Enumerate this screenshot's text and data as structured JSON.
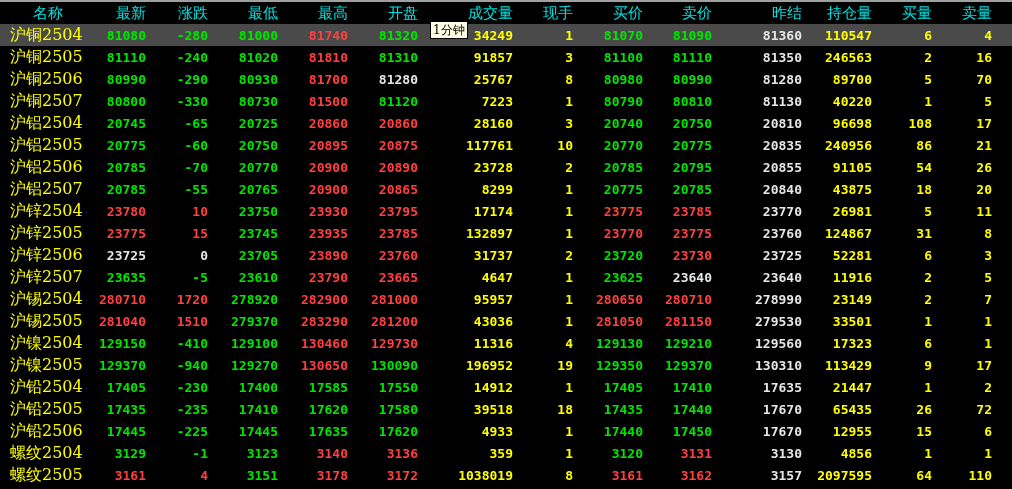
{
  "columns": [
    "名称",
    "最新",
    "涨跌",
    "最低",
    "最高",
    "开盘",
    "成交量",
    "现手",
    "买价",
    "卖价",
    "昨结",
    "持仓量",
    "买量",
    "卖量"
  ],
  "tooltip": {
    "text": "1分钟"
  },
  "rows": [
    {
      "name": "沪铜2504",
      "selected": true,
      "cells": [
        {
          "text": "81080",
          "color": "#00e600"
        },
        {
          "text": "-280",
          "color": "#00e600"
        },
        {
          "text": "81000",
          "color": "#00e600"
        },
        {
          "text": "81740",
          "color": "#ff4040"
        },
        {
          "text": "81320",
          "color": "#00e600"
        },
        {
          "text": "34249",
          "color": "#ffff00"
        },
        {
          "text": "1",
          "color": "#ffff00"
        },
        {
          "text": "81070",
          "color": "#00e600"
        },
        {
          "text": "81090",
          "color": "#00e600"
        },
        {
          "text": "81360",
          "color": "#e6e6e6"
        },
        {
          "text": "110547",
          "color": "#ffff00"
        },
        {
          "text": "6",
          "color": "#ffff00"
        },
        {
          "text": "4",
          "color": "#ffff00"
        }
      ]
    },
    {
      "name": "沪铜2505",
      "selected": false,
      "cells": [
        {
          "text": "81110",
          "color": "#00e600"
        },
        {
          "text": "-240",
          "color": "#00e600"
        },
        {
          "text": "81020",
          "color": "#00e600"
        },
        {
          "text": "81810",
          "color": "#ff4040"
        },
        {
          "text": "81310",
          "color": "#00e600"
        },
        {
          "text": "91857",
          "color": "#ffff00"
        },
        {
          "text": "3",
          "color": "#ffff00"
        },
        {
          "text": "81100",
          "color": "#00e600"
        },
        {
          "text": "81110",
          "color": "#00e600"
        },
        {
          "text": "81350",
          "color": "#e6e6e6"
        },
        {
          "text": "246563",
          "color": "#ffff00"
        },
        {
          "text": "2",
          "color": "#ffff00"
        },
        {
          "text": "16",
          "color": "#ffff00"
        }
      ]
    },
    {
      "name": "沪铜2506",
      "selected": false,
      "cells": [
        {
          "text": "80990",
          "color": "#00e600"
        },
        {
          "text": "-290",
          "color": "#00e600"
        },
        {
          "text": "80930",
          "color": "#00e600"
        },
        {
          "text": "81700",
          "color": "#ff4040"
        },
        {
          "text": "81280",
          "color": "#e6e6e6"
        },
        {
          "text": "25767",
          "color": "#ffff00"
        },
        {
          "text": "8",
          "color": "#ffff00"
        },
        {
          "text": "80980",
          "color": "#00e600"
        },
        {
          "text": "80990",
          "color": "#00e600"
        },
        {
          "text": "81280",
          "color": "#e6e6e6"
        },
        {
          "text": "89700",
          "color": "#ffff00"
        },
        {
          "text": "5",
          "color": "#ffff00"
        },
        {
          "text": "70",
          "color": "#ffff00"
        }
      ]
    },
    {
      "name": "沪铜2507",
      "selected": false,
      "cells": [
        {
          "text": "80800",
          "color": "#00e600"
        },
        {
          "text": "-330",
          "color": "#00e600"
        },
        {
          "text": "80730",
          "color": "#00e600"
        },
        {
          "text": "81500",
          "color": "#ff4040"
        },
        {
          "text": "81120",
          "color": "#00e600"
        },
        {
          "text": "7223",
          "color": "#ffff00"
        },
        {
          "text": "1",
          "color": "#ffff00"
        },
        {
          "text": "80790",
          "color": "#00e600"
        },
        {
          "text": "80810",
          "color": "#00e600"
        },
        {
          "text": "81130",
          "color": "#e6e6e6"
        },
        {
          "text": "40220",
          "color": "#ffff00"
        },
        {
          "text": "1",
          "color": "#ffff00"
        },
        {
          "text": "5",
          "color": "#ffff00"
        }
      ]
    },
    {
      "name": "沪铝2504",
      "selected": false,
      "cells": [
        {
          "text": "20745",
          "color": "#00e600"
        },
        {
          "text": "-65",
          "color": "#00e600"
        },
        {
          "text": "20725",
          "color": "#00e600"
        },
        {
          "text": "20860",
          "color": "#ff4040"
        },
        {
          "text": "20860",
          "color": "#ff4040"
        },
        {
          "text": "28160",
          "color": "#ffff00"
        },
        {
          "text": "3",
          "color": "#ffff00"
        },
        {
          "text": "20740",
          "color": "#00e600"
        },
        {
          "text": "20750",
          "color": "#00e600"
        },
        {
          "text": "20810",
          "color": "#e6e6e6"
        },
        {
          "text": "96698",
          "color": "#ffff00"
        },
        {
          "text": "108",
          "color": "#ffff00"
        },
        {
          "text": "17",
          "color": "#ffff00"
        }
      ]
    },
    {
      "name": "沪铝2505",
      "selected": false,
      "cells": [
        {
          "text": "20775",
          "color": "#00e600"
        },
        {
          "text": "-60",
          "color": "#00e600"
        },
        {
          "text": "20750",
          "color": "#00e600"
        },
        {
          "text": "20895",
          "color": "#ff4040"
        },
        {
          "text": "20875",
          "color": "#ff4040"
        },
        {
          "text": "117761",
          "color": "#ffff00"
        },
        {
          "text": "10",
          "color": "#ffff00"
        },
        {
          "text": "20770",
          "color": "#00e600"
        },
        {
          "text": "20775",
          "color": "#00e600"
        },
        {
          "text": "20835",
          "color": "#e6e6e6"
        },
        {
          "text": "240956",
          "color": "#ffff00"
        },
        {
          "text": "86",
          "color": "#ffff00"
        },
        {
          "text": "21",
          "color": "#ffff00"
        }
      ]
    },
    {
      "name": "沪铝2506",
      "selected": false,
      "cells": [
        {
          "text": "20785",
          "color": "#00e600"
        },
        {
          "text": "-70",
          "color": "#00e600"
        },
        {
          "text": "20770",
          "color": "#00e600"
        },
        {
          "text": "20900",
          "color": "#ff4040"
        },
        {
          "text": "20890",
          "color": "#ff4040"
        },
        {
          "text": "23728",
          "color": "#ffff00"
        },
        {
          "text": "2",
          "color": "#ffff00"
        },
        {
          "text": "20785",
          "color": "#00e600"
        },
        {
          "text": "20795",
          "color": "#00e600"
        },
        {
          "text": "20855",
          "color": "#e6e6e6"
        },
        {
          "text": "91105",
          "color": "#ffff00"
        },
        {
          "text": "54",
          "color": "#ffff00"
        },
        {
          "text": "26",
          "color": "#ffff00"
        }
      ]
    },
    {
      "name": "沪铝2507",
      "selected": false,
      "cells": [
        {
          "text": "20785",
          "color": "#00e600"
        },
        {
          "text": "-55",
          "color": "#00e600"
        },
        {
          "text": "20765",
          "color": "#00e600"
        },
        {
          "text": "20900",
          "color": "#ff4040"
        },
        {
          "text": "20865",
          "color": "#ff4040"
        },
        {
          "text": "8299",
          "color": "#ffff00"
        },
        {
          "text": "1",
          "color": "#ffff00"
        },
        {
          "text": "20775",
          "color": "#00e600"
        },
        {
          "text": "20785",
          "color": "#00e600"
        },
        {
          "text": "20840",
          "color": "#e6e6e6"
        },
        {
          "text": "43875",
          "color": "#ffff00"
        },
        {
          "text": "18",
          "color": "#ffff00"
        },
        {
          "text": "20",
          "color": "#ffff00"
        }
      ]
    },
    {
      "name": "沪锌2504",
      "selected": false,
      "cells": [
        {
          "text": "23780",
          "color": "#ff4040"
        },
        {
          "text": "10",
          "color": "#ff4040"
        },
        {
          "text": "23750",
          "color": "#00e600"
        },
        {
          "text": "23930",
          "color": "#ff4040"
        },
        {
          "text": "23795",
          "color": "#ff4040"
        },
        {
          "text": "17174",
          "color": "#ffff00"
        },
        {
          "text": "1",
          "color": "#ffff00"
        },
        {
          "text": "23775",
          "color": "#ff4040"
        },
        {
          "text": "23785",
          "color": "#ff4040"
        },
        {
          "text": "23770",
          "color": "#e6e6e6"
        },
        {
          "text": "26981",
          "color": "#ffff00"
        },
        {
          "text": "5",
          "color": "#ffff00"
        },
        {
          "text": "11",
          "color": "#ffff00"
        }
      ]
    },
    {
      "name": "沪锌2505",
      "selected": false,
      "cells": [
        {
          "text": "23775",
          "color": "#ff4040"
        },
        {
          "text": "15",
          "color": "#ff4040"
        },
        {
          "text": "23745",
          "color": "#00e600"
        },
        {
          "text": "23935",
          "color": "#ff4040"
        },
        {
          "text": "23785",
          "color": "#ff4040"
        },
        {
          "text": "132897",
          "color": "#ffff00"
        },
        {
          "text": "1",
          "color": "#ffff00"
        },
        {
          "text": "23770",
          "color": "#ff4040"
        },
        {
          "text": "23775",
          "color": "#ff4040"
        },
        {
          "text": "23760",
          "color": "#e6e6e6"
        },
        {
          "text": "124867",
          "color": "#ffff00"
        },
        {
          "text": "31",
          "color": "#ffff00"
        },
        {
          "text": "8",
          "color": "#ffff00"
        }
      ]
    },
    {
      "name": "沪锌2506",
      "selected": false,
      "cells": [
        {
          "text": "23725",
          "color": "#e6e6e6"
        },
        {
          "text": "0",
          "color": "#e6e6e6"
        },
        {
          "text": "23705",
          "color": "#00e600"
        },
        {
          "text": "23890",
          "color": "#ff4040"
        },
        {
          "text": "23760",
          "color": "#ff4040"
        },
        {
          "text": "31737",
          "color": "#ffff00"
        },
        {
          "text": "2",
          "color": "#ffff00"
        },
        {
          "text": "23720",
          "color": "#00e600"
        },
        {
          "text": "23730",
          "color": "#ff4040"
        },
        {
          "text": "23725",
          "color": "#e6e6e6"
        },
        {
          "text": "52281",
          "color": "#ffff00"
        },
        {
          "text": "6",
          "color": "#ffff00"
        },
        {
          "text": "3",
          "color": "#ffff00"
        }
      ]
    },
    {
      "name": "沪锌2507",
      "selected": false,
      "cells": [
        {
          "text": "23635",
          "color": "#00e600"
        },
        {
          "text": "-5",
          "color": "#00e600"
        },
        {
          "text": "23610",
          "color": "#00e600"
        },
        {
          "text": "23790",
          "color": "#ff4040"
        },
        {
          "text": "23665",
          "color": "#ff4040"
        },
        {
          "text": "4647",
          "color": "#ffff00"
        },
        {
          "text": "1",
          "color": "#ffff00"
        },
        {
          "text": "23625",
          "color": "#00e600"
        },
        {
          "text": "23640",
          "color": "#e6e6e6"
        },
        {
          "text": "23640",
          "color": "#e6e6e6"
        },
        {
          "text": "11916",
          "color": "#ffff00"
        },
        {
          "text": "2",
          "color": "#ffff00"
        },
        {
          "text": "5",
          "color": "#ffff00"
        }
      ]
    },
    {
      "name": "沪锡2504",
      "selected": false,
      "cells": [
        {
          "text": "280710",
          "color": "#ff4040"
        },
        {
          "text": "1720",
          "color": "#ff4040"
        },
        {
          "text": "278920",
          "color": "#00e600"
        },
        {
          "text": "282900",
          "color": "#ff4040"
        },
        {
          "text": "281000",
          "color": "#ff4040"
        },
        {
          "text": "95957",
          "color": "#ffff00"
        },
        {
          "text": "1",
          "color": "#ffff00"
        },
        {
          "text": "280650",
          "color": "#ff4040"
        },
        {
          "text": "280710",
          "color": "#ff4040"
        },
        {
          "text": "278990",
          "color": "#e6e6e6"
        },
        {
          "text": "23149",
          "color": "#ffff00"
        },
        {
          "text": "2",
          "color": "#ffff00"
        },
        {
          "text": "7",
          "color": "#ffff00"
        }
      ]
    },
    {
      "name": "沪锡2505",
      "selected": false,
      "cells": [
        {
          "text": "281040",
          "color": "#ff4040"
        },
        {
          "text": "1510",
          "color": "#ff4040"
        },
        {
          "text": "279370",
          "color": "#00e600"
        },
        {
          "text": "283290",
          "color": "#ff4040"
        },
        {
          "text": "281200",
          "color": "#ff4040"
        },
        {
          "text": "43036",
          "color": "#ffff00"
        },
        {
          "text": "1",
          "color": "#ffff00"
        },
        {
          "text": "281050",
          "color": "#ff4040"
        },
        {
          "text": "281150",
          "color": "#ff4040"
        },
        {
          "text": "279530",
          "color": "#e6e6e6"
        },
        {
          "text": "33501",
          "color": "#ffff00"
        },
        {
          "text": "1",
          "color": "#ffff00"
        },
        {
          "text": "1",
          "color": "#ffff00"
        }
      ]
    },
    {
      "name": "沪镍2504",
      "selected": false,
      "cells": [
        {
          "text": "129150",
          "color": "#00e600"
        },
        {
          "text": "-410",
          "color": "#00e600"
        },
        {
          "text": "129100",
          "color": "#00e600"
        },
        {
          "text": "130460",
          "color": "#ff4040"
        },
        {
          "text": "129730",
          "color": "#ff4040"
        },
        {
          "text": "11316",
          "color": "#ffff00"
        },
        {
          "text": "4",
          "color": "#ffff00"
        },
        {
          "text": "129130",
          "color": "#00e600"
        },
        {
          "text": "129210",
          "color": "#00e600"
        },
        {
          "text": "129560",
          "color": "#e6e6e6"
        },
        {
          "text": "17323",
          "color": "#ffff00"
        },
        {
          "text": "6",
          "color": "#ffff00"
        },
        {
          "text": "1",
          "color": "#ffff00"
        }
      ]
    },
    {
      "name": "沪镍2505",
      "selected": false,
      "cells": [
        {
          "text": "129370",
          "color": "#00e600"
        },
        {
          "text": "-940",
          "color": "#00e600"
        },
        {
          "text": "129270",
          "color": "#00e600"
        },
        {
          "text": "130650",
          "color": "#ff4040"
        },
        {
          "text": "130090",
          "color": "#00e600"
        },
        {
          "text": "196952",
          "color": "#ffff00"
        },
        {
          "text": "19",
          "color": "#ffff00"
        },
        {
          "text": "129350",
          "color": "#00e600"
        },
        {
          "text": "129370",
          "color": "#00e600"
        },
        {
          "text": "130310",
          "color": "#e6e6e6"
        },
        {
          "text": "113429",
          "color": "#ffff00"
        },
        {
          "text": "9",
          "color": "#ffff00"
        },
        {
          "text": "17",
          "color": "#ffff00"
        }
      ]
    },
    {
      "name": "沪铅2504",
      "selected": false,
      "cells": [
        {
          "text": "17405",
          "color": "#00e600"
        },
        {
          "text": "-230",
          "color": "#00e600"
        },
        {
          "text": "17400",
          "color": "#00e600"
        },
        {
          "text": "17585",
          "color": "#00e600"
        },
        {
          "text": "17550",
          "color": "#00e600"
        },
        {
          "text": "14912",
          "color": "#ffff00"
        },
        {
          "text": "1",
          "color": "#ffff00"
        },
        {
          "text": "17405",
          "color": "#00e600"
        },
        {
          "text": "17410",
          "color": "#00e600"
        },
        {
          "text": "17635",
          "color": "#e6e6e6"
        },
        {
          "text": "21447",
          "color": "#ffff00"
        },
        {
          "text": "1",
          "color": "#ffff00"
        },
        {
          "text": "2",
          "color": "#ffff00"
        }
      ]
    },
    {
      "name": "沪铅2505",
      "selected": false,
      "cells": [
        {
          "text": "17435",
          "color": "#00e600"
        },
        {
          "text": "-235",
          "color": "#00e600"
        },
        {
          "text": "17410",
          "color": "#00e600"
        },
        {
          "text": "17620",
          "color": "#00e600"
        },
        {
          "text": "17580",
          "color": "#00e600"
        },
        {
          "text": "39518",
          "color": "#ffff00"
        },
        {
          "text": "18",
          "color": "#ffff00"
        },
        {
          "text": "17435",
          "color": "#00e600"
        },
        {
          "text": "17440",
          "color": "#00e600"
        },
        {
          "text": "17670",
          "color": "#e6e6e6"
        },
        {
          "text": "65435",
          "color": "#ffff00"
        },
        {
          "text": "26",
          "color": "#ffff00"
        },
        {
          "text": "72",
          "color": "#ffff00"
        }
      ]
    },
    {
      "name": "沪铅2506",
      "selected": false,
      "cells": [
        {
          "text": "17445",
          "color": "#00e600"
        },
        {
          "text": "-225",
          "color": "#00e600"
        },
        {
          "text": "17445",
          "color": "#00e600"
        },
        {
          "text": "17635",
          "color": "#00e600"
        },
        {
          "text": "17620",
          "color": "#00e600"
        },
        {
          "text": "4933",
          "color": "#ffff00"
        },
        {
          "text": "1",
          "color": "#ffff00"
        },
        {
          "text": "17440",
          "color": "#00e600"
        },
        {
          "text": "17450",
          "color": "#00e600"
        },
        {
          "text": "17670",
          "color": "#e6e6e6"
        },
        {
          "text": "12955",
          "color": "#ffff00"
        },
        {
          "text": "15",
          "color": "#ffff00"
        },
        {
          "text": "6",
          "color": "#ffff00"
        }
      ]
    },
    {
      "name": "螺纹2504",
      "selected": false,
      "cells": [
        {
          "text": "3129",
          "color": "#00e600"
        },
        {
          "text": "-1",
          "color": "#00e600"
        },
        {
          "text": "3123",
          "color": "#00e600"
        },
        {
          "text": "3140",
          "color": "#ff4040"
        },
        {
          "text": "3136",
          "color": "#ff4040"
        },
        {
          "text": "359",
          "color": "#ffff00"
        },
        {
          "text": "1",
          "color": "#ffff00"
        },
        {
          "text": "3120",
          "color": "#00e600"
        },
        {
          "text": "3131",
          "color": "#ff4040"
        },
        {
          "text": "3130",
          "color": "#e6e6e6"
        },
        {
          "text": "4856",
          "color": "#ffff00"
        },
        {
          "text": "1",
          "color": "#ffff00"
        },
        {
          "text": "1",
          "color": "#ffff00"
        }
      ]
    },
    {
      "name": "螺纹2505",
      "selected": false,
      "cells": [
        {
          "text": "3161",
          "color": "#ff4040"
        },
        {
          "text": "4",
          "color": "#ff4040"
        },
        {
          "text": "3151",
          "color": "#00e600"
        },
        {
          "text": "3178",
          "color": "#ff4040"
        },
        {
          "text": "3172",
          "color": "#ff4040"
        },
        {
          "text": "1038019",
          "color": "#ffff00"
        },
        {
          "text": "8",
          "color": "#ffff00"
        },
        {
          "text": "3161",
          "color": "#ff4040"
        },
        {
          "text": "3162",
          "color": "#ff4040"
        },
        {
          "text": "3157",
          "color": "#e6e6e6"
        },
        {
          "text": "2097595",
          "color": "#ffff00"
        },
        {
          "text": "64",
          "color": "#ffff00"
        },
        {
          "text": "110",
          "color": "#ffff00"
        }
      ]
    }
  ]
}
